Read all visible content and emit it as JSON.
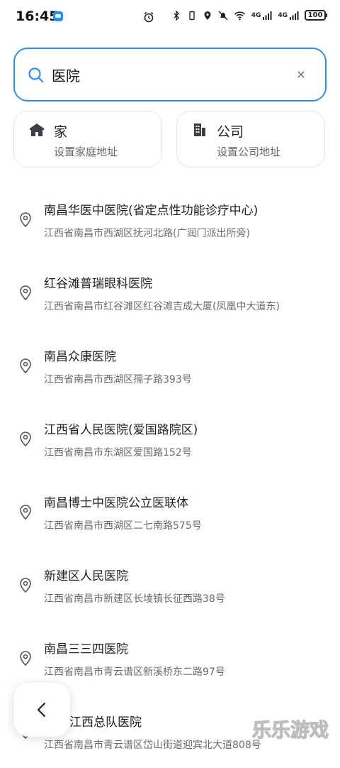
{
  "status_bar": {
    "time": "16:45",
    "battery": "100",
    "network_1": "4G",
    "network_2": "4G"
  },
  "search": {
    "value": "医院",
    "placeholder": "",
    "clear_symbol": "×"
  },
  "shortcuts": {
    "home": {
      "title": "家",
      "subtitle": "设置家庭地址",
      "icon": "house-icon"
    },
    "company": {
      "title": "公司",
      "subtitle": "设置公司地址",
      "icon": "building-icon"
    }
  },
  "results": [
    {
      "name": "南昌华医中医院(省定点性功能诊疗中心)",
      "address": "江西省南昌市西湖区抚河北路(广润门派出所旁)"
    },
    {
      "name": "红谷滩普瑞眼科医院",
      "address": "江西省南昌市红谷滩区红谷滩吉成大厦(凤凰中大道东)"
    },
    {
      "name": "南昌众康医院",
      "address": "江西省南昌市西湖区孺子路393号"
    },
    {
      "name": "江西省人民医院(爱国路院区)",
      "address": "江西省南昌市东湖区爱国路152号"
    },
    {
      "name": "南昌博士中医院公立医联体",
      "address": "江西省南昌市西湖区二七南路575号"
    },
    {
      "name": "新建区人民医院",
      "address": "江西省南昌市新建区长堎镇长征西路38号"
    },
    {
      "name": "南昌三三四医院",
      "address": "江西省南昌市青云谱区新溪桥东二路97号"
    },
    {
      "name": "江西总队医院",
      "address": "江西省南昌市青云谱区岱山街道迎宾北大道808号"
    }
  ],
  "watermark": "乐乐游戏",
  "colors": {
    "accent": "#2a8cff",
    "text_primary": "#1f1f1f",
    "text_secondary": "#6b6b6b"
  }
}
